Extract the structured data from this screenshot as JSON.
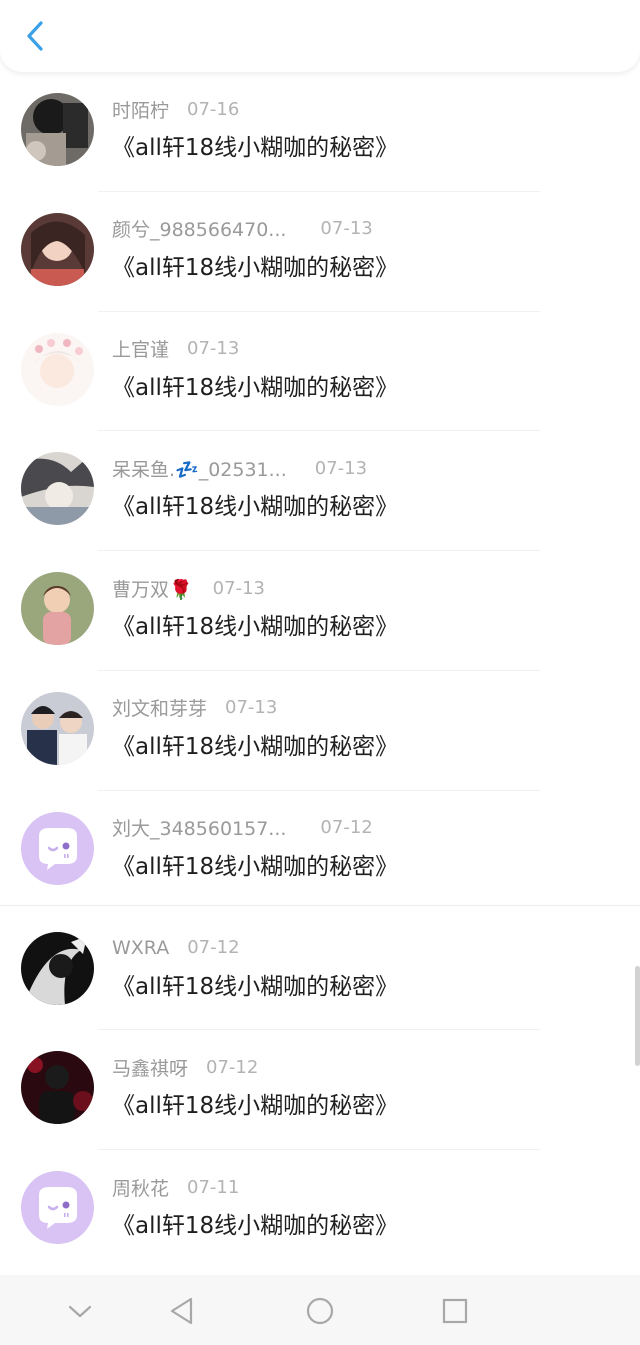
{
  "header": {
    "back_icon": "chevron-left-icon",
    "accent": "#3aa0e8"
  },
  "list": [
    {
      "name": "时陌柠",
      "date": "07-16",
      "title": "《all轩18线小糊咖的秘密》",
      "avatar": "photo-dark"
    },
    {
      "name": "颜兮_988566470...",
      "date": "07-13",
      "title": "《all轩18线小糊咖的秘密》",
      "avatar": "anime-girl"
    },
    {
      "name": "上官谨",
      "date": "07-13",
      "title": "《all轩18线小糊咖的秘密》",
      "avatar": "anime-flowers"
    },
    {
      "name": "呆呆鱼.💤_02531...",
      "date": "07-13",
      "title": "《all轩18线小糊咖的秘密》",
      "avatar": "anime-sleep"
    },
    {
      "name": "曹万双🌹",
      "date": "07-13",
      "title": "《all轩18线小糊咖的秘密》",
      "avatar": "photo-child"
    },
    {
      "name": "刘文和芽芽",
      "date": "07-13",
      "title": "《all轩18线小糊咖的秘密》",
      "avatar": "photo-couple"
    },
    {
      "name": "刘大_348560157...",
      "date": "07-12",
      "title": "《all轩18线小糊咖的秘密》",
      "avatar": "default-bubble"
    },
    {
      "name": "WXRA",
      "date": "07-12",
      "title": "《all轩18线小糊咖的秘密》",
      "avatar": "photo-bw"
    },
    {
      "name": "马鑫祺呀",
      "date": "07-12",
      "title": "《all轩18线小糊咖的秘密》",
      "avatar": "photo-red"
    },
    {
      "name": "周秋花",
      "date": "07-11",
      "title": "《all轩18线小糊咖的秘密》",
      "avatar": "default-bubble"
    }
  ],
  "navbar": {
    "items": [
      {
        "icon": "chevron-down-icon"
      },
      {
        "icon": "back-triangle-icon"
      },
      {
        "icon": "home-circle-icon"
      },
      {
        "icon": "recents-square-icon"
      }
    ]
  },
  "colors": {
    "default_avatar_bg": "#d8c3f4",
    "name_text": "#9a9a9a",
    "title_text": "#1f1f1f"
  }
}
